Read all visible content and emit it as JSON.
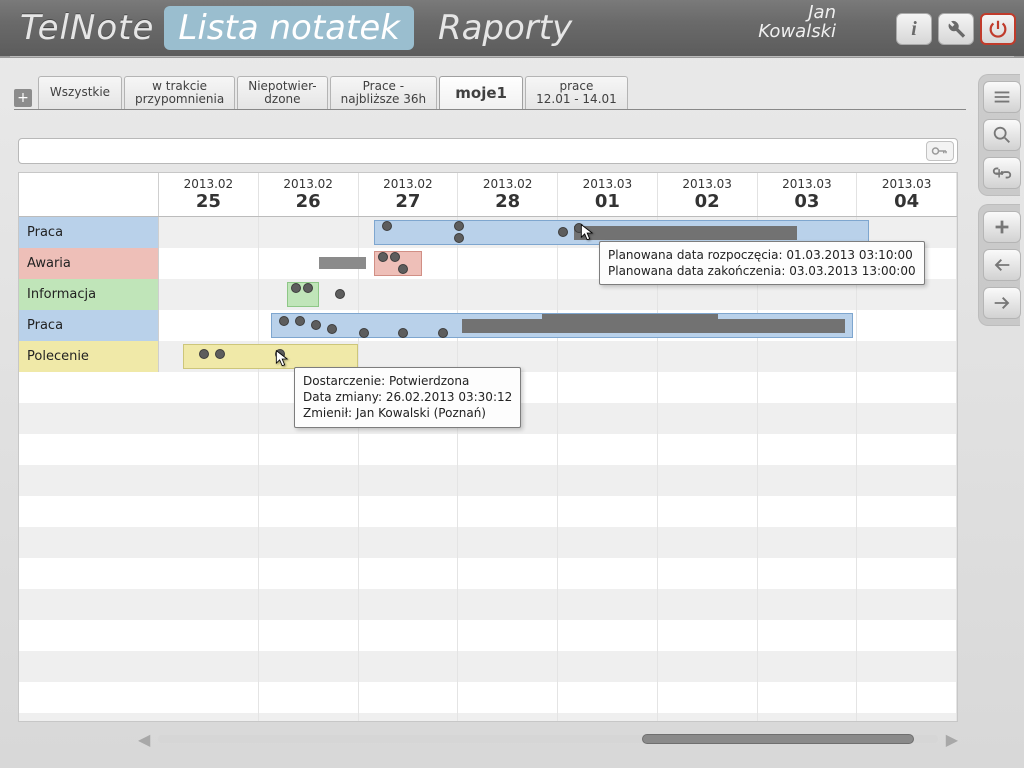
{
  "header": {
    "app_name": "TelNote",
    "tabs": [
      {
        "label": "Lista notatek",
        "active": true
      },
      {
        "label": "Raporty",
        "active": false
      }
    ],
    "user_first": "Jan",
    "user_last": "Kowalski"
  },
  "filters": {
    "items": [
      {
        "label": "Wszystkie"
      },
      {
        "label": "w trakcie\nprzypomnienia"
      },
      {
        "label": "Niepotwier-\ndzone"
      },
      {
        "label": "Prace -\nnajbliższe 36h"
      },
      {
        "label": "moje1",
        "active": true
      },
      {
        "label": "prace\n12.01 - 14.01"
      }
    ]
  },
  "search": {
    "value": "",
    "placeholder": ""
  },
  "dates": [
    {
      "ym": "2013.02",
      "d": "25"
    },
    {
      "ym": "2013.02",
      "d": "26"
    },
    {
      "ym": "2013.02",
      "d": "27"
    },
    {
      "ym": "2013.02",
      "d": "28"
    },
    {
      "ym": "2013.03",
      "d": "01"
    },
    {
      "ym": "2013.03",
      "d": "02"
    },
    {
      "ym": "2013.03",
      "d": "03"
    },
    {
      "ym": "2013.03",
      "d": "04"
    }
  ],
  "rows": [
    {
      "label": "Praca"
    },
    {
      "label": "Awaria"
    },
    {
      "label": "Informacja"
    },
    {
      "label": "Praca"
    },
    {
      "label": "Polecenie"
    }
  ],
  "tooltip_top": {
    "line1": "Planowana data rozpoczęcia: 01.03.2013 03:10:00",
    "line2": "Planowana data zakończenia: 03.03.2013 13:00:00"
  },
  "tooltip_bottom": {
    "line1": "Dostarczenie: Potwierdzona",
    "line2": "Data zmiany: 26.02.2013 03:30:12",
    "line3": "Zmienił: Jan Kowalski (Poznań)"
  },
  "colors": {
    "blue": "#b9d1ea",
    "red": "#eebfb8",
    "green": "#c0e5b9",
    "yellow": "#f0e9a8",
    "grey": "#8b8b8b"
  }
}
